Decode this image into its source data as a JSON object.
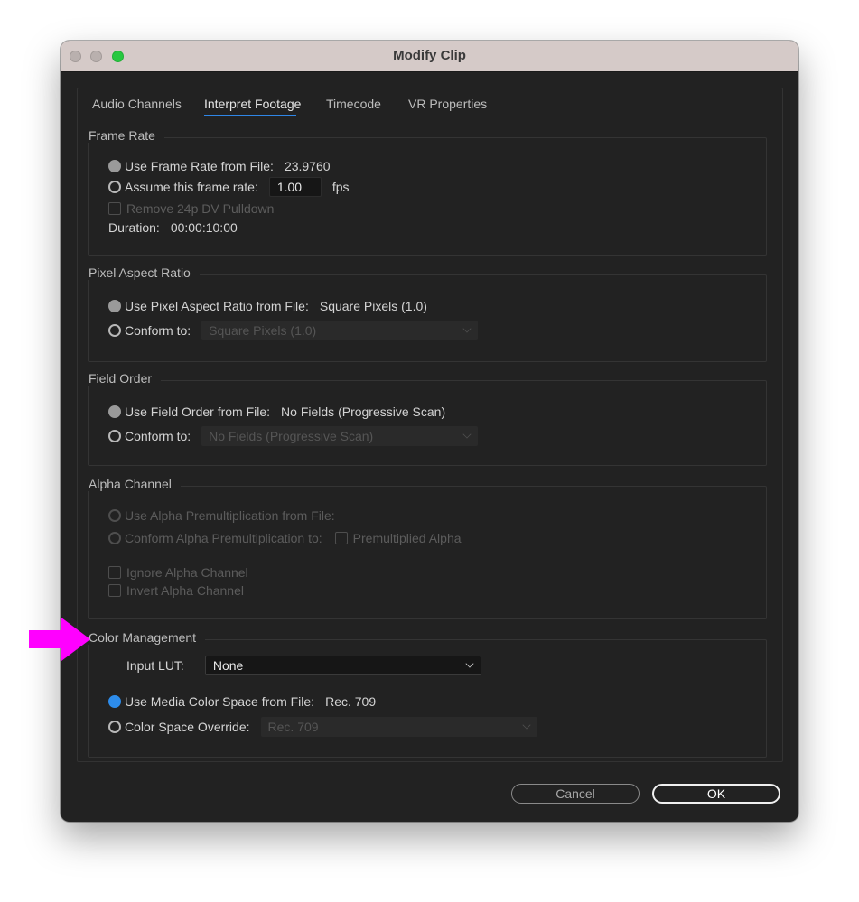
{
  "window": {
    "title": "Modify Clip"
  },
  "tabs": [
    {
      "label": "Audio Channels",
      "active": false
    },
    {
      "label": "Interpret Footage",
      "active": true
    },
    {
      "label": "Timecode",
      "active": false
    },
    {
      "label": "VR Properties",
      "active": false
    }
  ],
  "frame_rate": {
    "title": "Frame Rate",
    "use_from_file_label": "Use Frame Rate from File:",
    "use_from_file_value": "23.9760",
    "assume_label": "Assume this frame rate:",
    "assume_value": "1.00",
    "assume_unit": "fps",
    "pulldown_label": "Remove 24p DV Pulldown",
    "duration_label": "Duration:",
    "duration_value": "00:00:10:00"
  },
  "pixel_aspect": {
    "title": "Pixel Aspect Ratio",
    "use_from_file_label": "Use Pixel Aspect Ratio from File:",
    "use_from_file_value": "Square Pixels (1.0)",
    "conform_label": "Conform to:",
    "conform_value": "Square Pixels (1.0)"
  },
  "field_order": {
    "title": "Field Order",
    "use_from_file_label": "Use Field Order from File:",
    "use_from_file_value": "No Fields (Progressive Scan)",
    "conform_label": "Conform to:",
    "conform_value": "No Fields (Progressive Scan)"
  },
  "alpha": {
    "title": "Alpha Channel",
    "use_from_file_label": "Use Alpha Premultiplication from File:",
    "conform_label": "Conform Alpha Premultiplication to:",
    "premult_label": "Premultiplied Alpha",
    "ignore_label": "Ignore Alpha Channel",
    "invert_label": "Invert Alpha Channel"
  },
  "color": {
    "title": "Color Management",
    "lut_label": "Input LUT:",
    "lut_value": "None",
    "use_media_label": "Use Media Color Space from File:",
    "use_media_value": "Rec. 709",
    "override_label": "Color Space Override:",
    "override_value": "Rec. 709"
  },
  "buttons": {
    "cancel": "Cancel",
    "ok": "OK"
  },
  "annotation": {
    "arrow_color": "#ff00ff"
  }
}
